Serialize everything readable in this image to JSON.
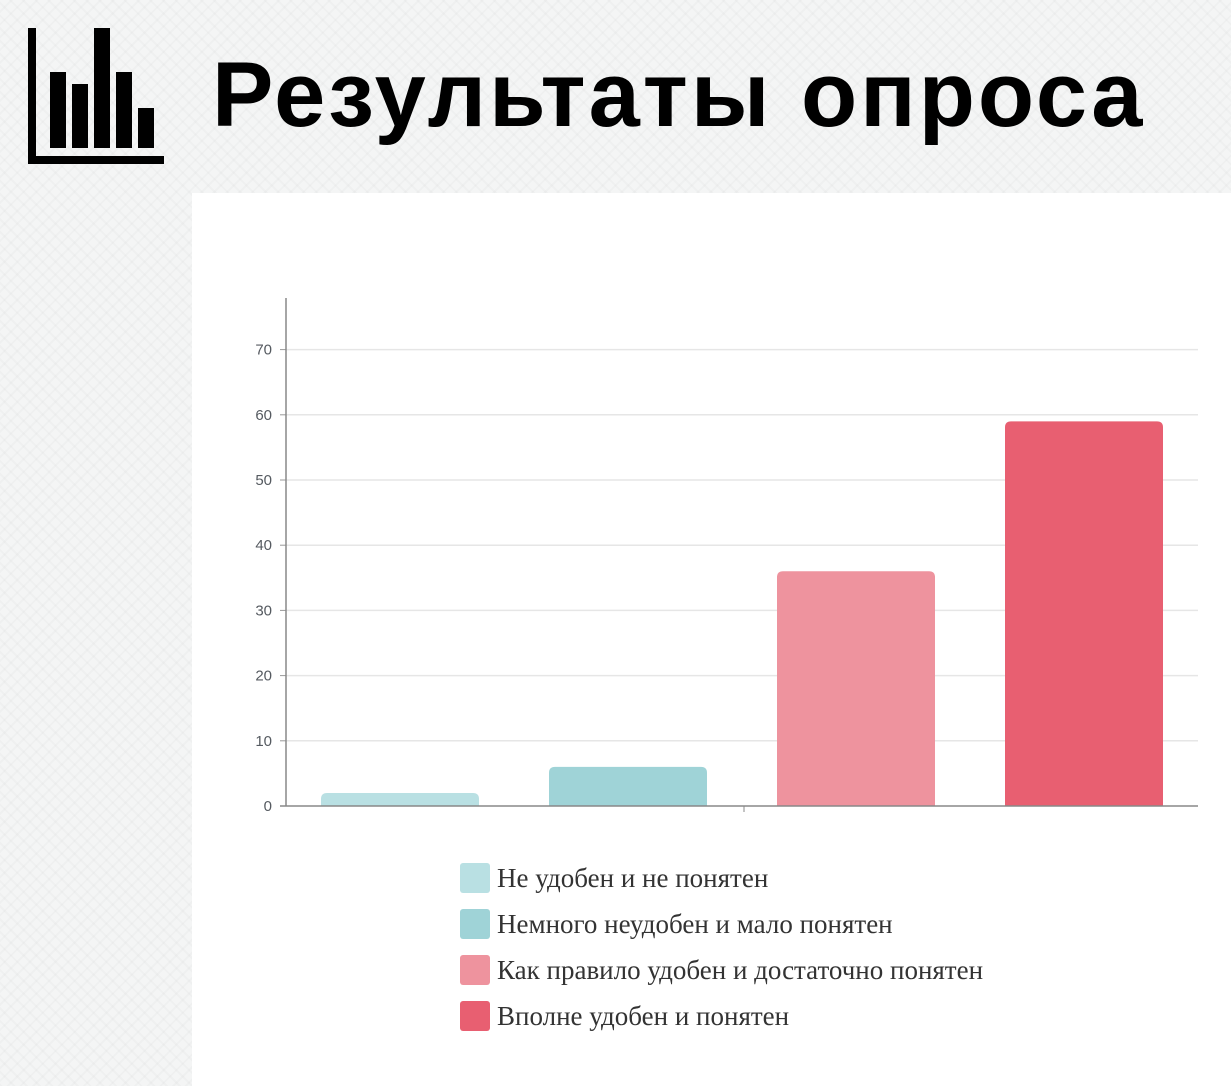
{
  "header": {
    "title": "Результаты опроса",
    "icon": "bar-chart-icon"
  },
  "chart_data": {
    "type": "bar",
    "title": "",
    "xlabel": "",
    "ylabel": "",
    "ylim": [
      0,
      78
    ],
    "yticks": [
      0,
      10,
      20,
      30,
      40,
      50,
      60,
      70
    ],
    "grid": true,
    "legend_position": "bottom",
    "categories": [
      "Не удобен и не понятен",
      "Немного неудобен и мало понятен",
      "Как правило удобен и достаточно понятен",
      "Вполне удобен и понятен"
    ],
    "values": [
      2,
      6,
      36,
      59
    ],
    "colors": [
      "#b9e0e3",
      "#9fd3d7",
      "#ee939e",
      "#e85f71"
    ]
  }
}
